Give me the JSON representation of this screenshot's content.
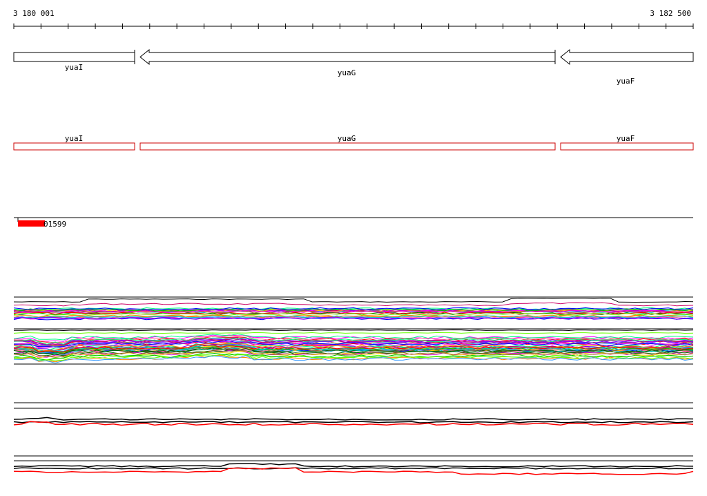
{
  "ruler": {
    "start_label": "3 180 001",
    "end_label": "3 182 500",
    "start": 3180001,
    "end": 3182500
  },
  "genes": [
    {
      "name": "yuaI",
      "start": 3180001,
      "end": 3180447,
      "strand": "+"
    },
    {
      "name": "yuaG",
      "start": 3180468,
      "end": 3182018,
      "strand": "-"
    },
    {
      "name": "yuaF",
      "start": 3182039,
      "end": 3182500,
      "strand": "-"
    }
  ],
  "probe": {
    "label": "01599",
    "color": "#ff0000"
  },
  "colors": {
    "gene_outline": "#000000",
    "annotation_outline": "#cc0000",
    "track_line": "#000000",
    "highlight": "#ff0000"
  }
}
